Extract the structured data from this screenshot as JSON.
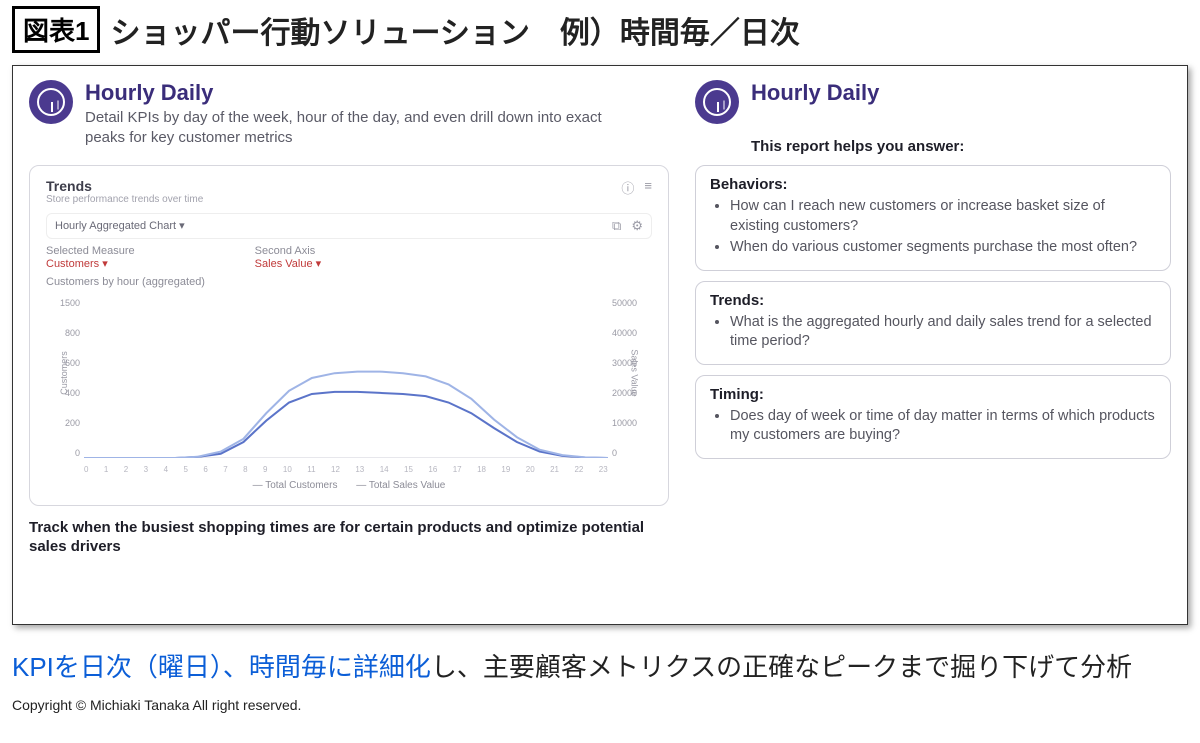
{
  "title": {
    "badge": "図表1",
    "text": "ショッパー行動ソリューション　例）時間毎／日次"
  },
  "left": {
    "heading": "Hourly Daily",
    "subheading": "Detail KPIs by day of the week, hour of the day, and even drill down into exact peaks for key customer metrics",
    "card": {
      "title": "Trends",
      "subtitle": "Store performance trends over time",
      "dropdown": "Hourly Aggregated Chart ▾",
      "measure_label": "Selected Measure",
      "measure_value": "Customers ▾",
      "axis2_label": "Second Axis",
      "axis2_value": "Sales Value ▾",
      "group_label": "Customers by hour (aggregated)",
      "legend1": "— Total Customers",
      "legend2": "— Total Sales Value",
      "ylabel": "Customers",
      "ylabel2": "Sales Value"
    },
    "caption": "Track when the busiest shopping times are for certain products and optimize potential sales drivers"
  },
  "right": {
    "heading": "Hourly Daily",
    "subheading": "This report helps you answer:",
    "boxes": [
      {
        "title": "Behaviors:",
        "items": [
          "How can I reach new customers or increase basket size of existing customers?",
          "When do various customer segments purchase the most often?"
        ]
      },
      {
        "title": "Trends:",
        "items": [
          "What is the aggregated hourly and daily sales trend for a selected time period?"
        ]
      },
      {
        "title": "Timing:",
        "items": [
          "Does day of week or time of day matter in terms of which products my customers are buying?"
        ]
      }
    ]
  },
  "bottom": {
    "blue": "KPIを日次（曜日）、時間毎に詳細化",
    "rest": "し、主要顧客メトリクスの正確なピークまで掘り下げて分析"
  },
  "copyright": "Copyright © Michiaki Tanaka All right reserved.",
  "chart_data": {
    "type": "line",
    "categories": [
      "0",
      "1",
      "2",
      "3",
      "4",
      "5",
      "6",
      "7",
      "8",
      "9",
      "10",
      "11",
      "12",
      "13",
      "14",
      "15",
      "16",
      "17",
      "18",
      "19",
      "20",
      "21",
      "22",
      "23"
    ],
    "series": [
      {
        "name": "Total Customers",
        "values": [
          0,
          0,
          0,
          0,
          0,
          10,
          40,
          150,
          350,
          520,
          600,
          620,
          620,
          610,
          600,
          580,
          520,
          420,
          280,
          150,
          60,
          20,
          5,
          0
        ]
      },
      {
        "name": "Total Sales Value",
        "values": [
          0,
          0,
          0,
          0,
          0,
          400,
          2000,
          6000,
          14000,
          21000,
          25000,
          26500,
          27000,
          27000,
          26500,
          25500,
          23000,
          18500,
          12000,
          6500,
          2600,
          900,
          200,
          0
        ]
      }
    ],
    "yticks_left": [
      "1500",
      "800",
      "600",
      "400",
      "200",
      "0"
    ],
    "yticks_right": [
      "50000",
      "40000",
      "30000",
      "20000",
      "10000",
      "0"
    ],
    "ylim_left": [
      0,
      1500
    ],
    "ylim_right": [
      0,
      50000
    ]
  }
}
